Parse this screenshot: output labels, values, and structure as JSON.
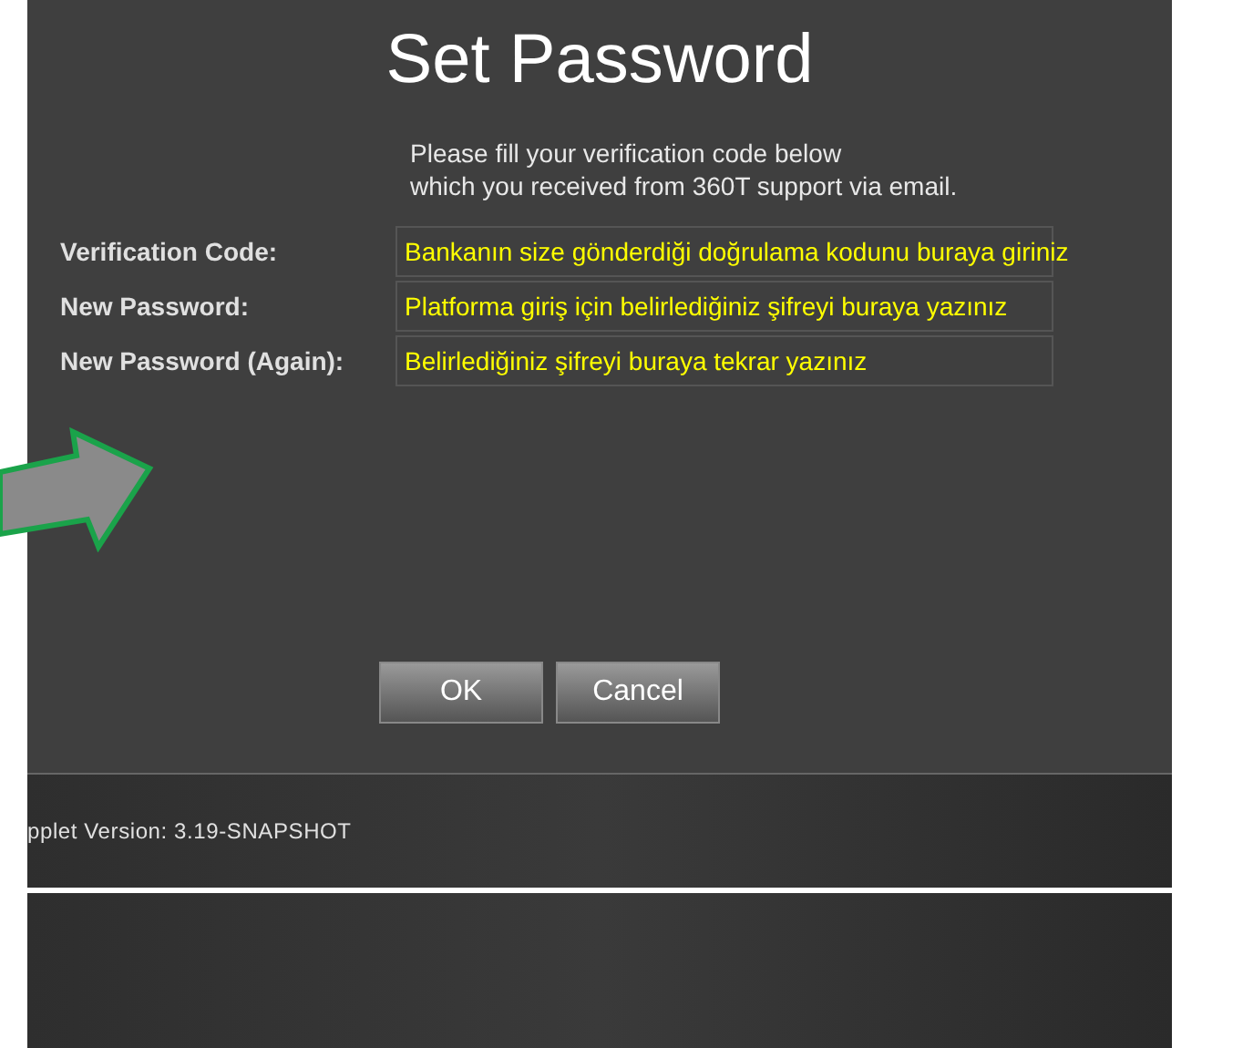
{
  "dialog": {
    "title": "Set Password",
    "instructions": [
      "Please fill your verification code below",
      "which you received from 360T support via email."
    ],
    "fields": [
      {
        "label": "Verification Code:",
        "annotation": "Bankanın size gönderdiği doğrulama kodunu buraya giriniz"
      },
      {
        "label": "New Password:",
        "annotation": "Platforma giriş için belirlediğiniz  şifreyi buraya yazınız"
      },
      {
        "label": "New Password (Again):",
        "annotation": "Belirlediğiniz şifreyi buraya tekrar yazınız"
      }
    ],
    "buttons": [
      "OK",
      "Cancel"
    ]
  },
  "footer": {
    "version": "pplet Version: 3.19-SNAPSHOT"
  }
}
